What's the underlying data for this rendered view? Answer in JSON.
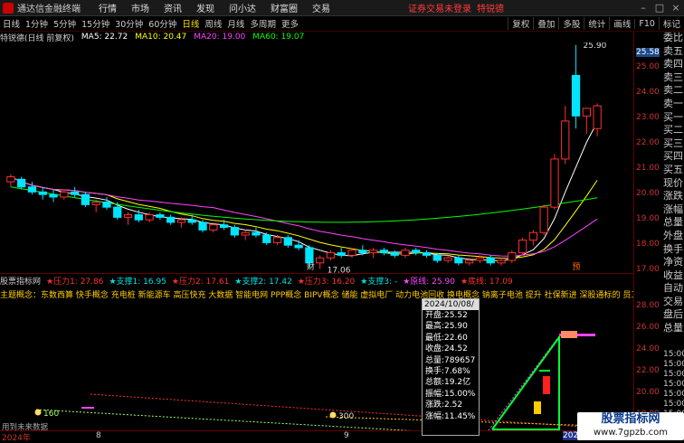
{
  "window": {
    "app_title": "通达信金融终端",
    "menu": [
      "行情",
      "市场",
      "资讯",
      "发现",
      "问小达",
      "财富圈",
      "交易"
    ],
    "warning": "证券交易未登录",
    "stock_name_top": "特锐德"
  },
  "toolbar": {
    "periods": [
      "日线",
      "1分钟",
      "5分钟",
      "15分钟",
      "30分钟",
      "60分钟",
      "日线",
      "周线",
      "月线",
      "多周期",
      "更多"
    ],
    "selected_index": 6,
    "right_tools": [
      "复权",
      "叠加",
      "多股",
      "统计",
      "画线",
      "F10",
      "标记"
    ]
  },
  "infobar": {
    "title": "特锐德(日线 前复权)",
    "ma5": "MA5: 22.72",
    "ma10": "MA10: 20.47",
    "ma20": "MA20: 19.00",
    "ma60": "MA60: 19.07",
    "colors": {
      "ma5": "#ffffff",
      "ma10": "#ffff00",
      "ma20": "#ff44ff",
      "ma60": "#00ff00"
    }
  },
  "main_axis_labels": [
    "25.58",
    "25.00",
    "24.00",
    "23.00",
    "22.00",
    "21.00",
    "20.00",
    "19.00",
    "18.00",
    "17.00"
  ],
  "main_annotations": {
    "high": "25.90",
    "low": "17.06",
    "cai": "财",
    "yu": "预"
  },
  "indicator": {
    "name": "股票指标网",
    "items": [
      {
        "text": "压力1: 27.86",
        "color": "#ff3030"
      },
      {
        "text": "支撑1: 16.95",
        "color": "#00e0e0"
      },
      {
        "text": "压力2: 17.61",
        "color": "#ff3030"
      },
      {
        "text": "支撑2: 17.42",
        "color": "#00e0e0"
      },
      {
        "text": "压力3: 16.20",
        "color": "#ff3030"
      },
      {
        "text": "支撑3: -",
        "color": "#00e0e0"
      },
      {
        "text": "原线: 25.90",
        "color": "#ff44ff"
      },
      {
        "text": "底线: 17.09",
        "color": "#ff3030"
      }
    ]
  },
  "concepts": "主题概念：东数西算 快手概念 充电桩 新能源车 高压快充 大数据 智能电网 PPP概念 BIPV概念 储能 虚拟电厂 动力电池回收 换电概念 钠离子电池 提升 社保新进 深股通标的 员工持股 非周期股",
  "low_axis_labels": [
    "28.00",
    "26.00",
    "24.00",
    "22.00",
    "20.00",
    "18.00"
  ],
  "low_labels": [
    "160",
    "300",
    "060",
    "200",
    "090"
  ],
  "tooltip": {
    "date": "2024/10/08/二",
    "rows": [
      "开盘:25.52",
      "最高:25.90",
      "最低:22.60",
      "收盘:24.52",
      "总量:789657",
      "换手:7.68%",
      "总额:19.2亿",
      "振幅:15.00%",
      "涨跌:2.52",
      "涨幅:11.45%"
    ]
  },
  "dates": {
    "left": "2024年",
    "m8": "8",
    "m9": "9",
    "right": "2024/10/08"
  },
  "empty_data": "用到未来数据",
  "right_panel": [
    "委比",
    "卖五",
    "卖四",
    "卖三",
    "卖二",
    "卖一",
    "买一",
    "买二",
    "买三",
    "买四",
    "买五",
    "现价",
    "涨跌",
    "涨幅",
    "总量",
    "外盘",
    "换手",
    "净资",
    "收益",
    "自动",
    "交易",
    "盘后",
    "总量"
  ],
  "right_lower_axis": [
    "15:00",
    "15:00",
    "15:00",
    "15:00",
    "15:00",
    "15:00",
    "15:00",
    "15:00"
  ],
  "watermark": {
    "title": "股票指标网",
    "url": "www.7gpzb.com"
  },
  "chart_data": {
    "type": "candlestick",
    "candles": [
      [
        20.5,
        20.8,
        20.3,
        20.7
      ],
      [
        20.6,
        20.7,
        20.2,
        20.3
      ],
      [
        20.3,
        20.5,
        20.0,
        20.1
      ],
      [
        20.1,
        20.3,
        19.8,
        20.0
      ],
      [
        20.0,
        20.2,
        19.7,
        19.9
      ],
      [
        19.9,
        20.2,
        19.8,
        20.1
      ],
      [
        20.1,
        20.3,
        19.9,
        20.0
      ],
      [
        20.0,
        20.1,
        19.5,
        19.6
      ],
      [
        19.6,
        19.8,
        19.3,
        19.7
      ],
      [
        19.7,
        19.9,
        19.4,
        19.5
      ],
      [
        19.5,
        19.7,
        19.0,
        19.1
      ],
      [
        19.1,
        19.3,
        18.8,
        19.2
      ],
      [
        19.2,
        19.4,
        18.9,
        19.0
      ],
      [
        19.0,
        19.3,
        18.9,
        19.2
      ],
      [
        19.2,
        19.3,
        19.0,
        19.1
      ],
      [
        19.1,
        19.2,
        18.8,
        18.9
      ],
      [
        18.9,
        19.1,
        18.7,
        19.0
      ],
      [
        19.0,
        19.2,
        18.8,
        18.9
      ],
      [
        18.9,
        19.0,
        18.5,
        18.6
      ],
      [
        18.6,
        18.9,
        18.5,
        18.8
      ],
      [
        18.8,
        19.0,
        18.6,
        18.7
      ],
      [
        18.7,
        18.8,
        18.3,
        18.4
      ],
      [
        18.4,
        18.6,
        18.2,
        18.5
      ],
      [
        18.5,
        18.7,
        18.3,
        18.4
      ],
      [
        18.4,
        18.5,
        18.0,
        18.1
      ],
      [
        18.1,
        18.4,
        18.0,
        18.3
      ],
      [
        18.3,
        18.4,
        17.9,
        18.0
      ],
      [
        18.0,
        18.2,
        17.8,
        17.9
      ],
      [
        17.9,
        18.0,
        17.1,
        17.3
      ],
      [
        17.3,
        17.6,
        17.06,
        17.5
      ],
      [
        17.5,
        17.8,
        17.4,
        17.7
      ],
      [
        17.7,
        17.9,
        17.5,
        17.6
      ],
      [
        17.6,
        17.9,
        17.5,
        17.8
      ],
      [
        17.8,
        18.0,
        17.6,
        17.7
      ],
      [
        17.7,
        17.9,
        17.5,
        17.8
      ],
      [
        17.8,
        17.9,
        17.6,
        17.7
      ],
      [
        17.7,
        17.8,
        17.5,
        17.6
      ],
      [
        17.6,
        17.9,
        17.5,
        17.8
      ],
      [
        17.8,
        17.9,
        17.6,
        17.7
      ],
      [
        17.7,
        17.8,
        17.5,
        17.6
      ],
      [
        17.6,
        17.7,
        17.3,
        17.4
      ],
      [
        17.4,
        17.6,
        17.3,
        17.5
      ],
      [
        17.5,
        17.6,
        17.2,
        17.3
      ],
      [
        17.3,
        17.5,
        17.2,
        17.4
      ],
      [
        17.4,
        17.6,
        17.3,
        17.5
      ],
      [
        17.5,
        17.6,
        17.2,
        17.3
      ],
      [
        17.3,
        17.5,
        17.2,
        17.4
      ],
      [
        17.4,
        17.8,
        17.3,
        17.7
      ],
      [
        17.7,
        18.3,
        17.6,
        18.2
      ],
      [
        18.2,
        18.6,
        18.0,
        18.5
      ],
      [
        18.5,
        19.6,
        18.4,
        19.5
      ],
      [
        19.5,
        21.6,
        19.4,
        21.4
      ],
      [
        21.4,
        23.5,
        21.2,
        22.9
      ],
      [
        24.7,
        25.9,
        22.6,
        23.1
      ],
      [
        23.1,
        23.3,
        22.4,
        23.4
      ],
      [
        22.6,
        23.6,
        22.3,
        23.5
      ]
    ],
    "ma_series": [
      {
        "name": "MA5",
        "color": "#ffffff"
      },
      {
        "name": "MA10",
        "color": "#ffff00"
      },
      {
        "name": "MA20",
        "color": "#ff44ff"
      },
      {
        "name": "MA60",
        "color": "#00ff00"
      }
    ],
    "ylim": [
      16.9,
      26.0
    ]
  }
}
